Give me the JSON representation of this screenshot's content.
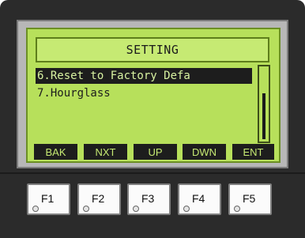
{
  "screen": {
    "title": "SETTING",
    "menu_items": [
      {
        "label": "6.Reset to Factory Defa",
        "selected": true
      },
      {
        "label": "7.Hourglass",
        "selected": false
      }
    ],
    "softkeys": [
      "BAK",
      "NXT",
      "UP",
      "DWN",
      "ENT"
    ]
  },
  "function_keys": [
    "F1",
    "F2",
    "F3",
    "F4",
    "F5"
  ],
  "colors": {
    "lcd": "#b7e05b",
    "bezel": "#2b2b2b",
    "selection": "#1d1d1d"
  }
}
